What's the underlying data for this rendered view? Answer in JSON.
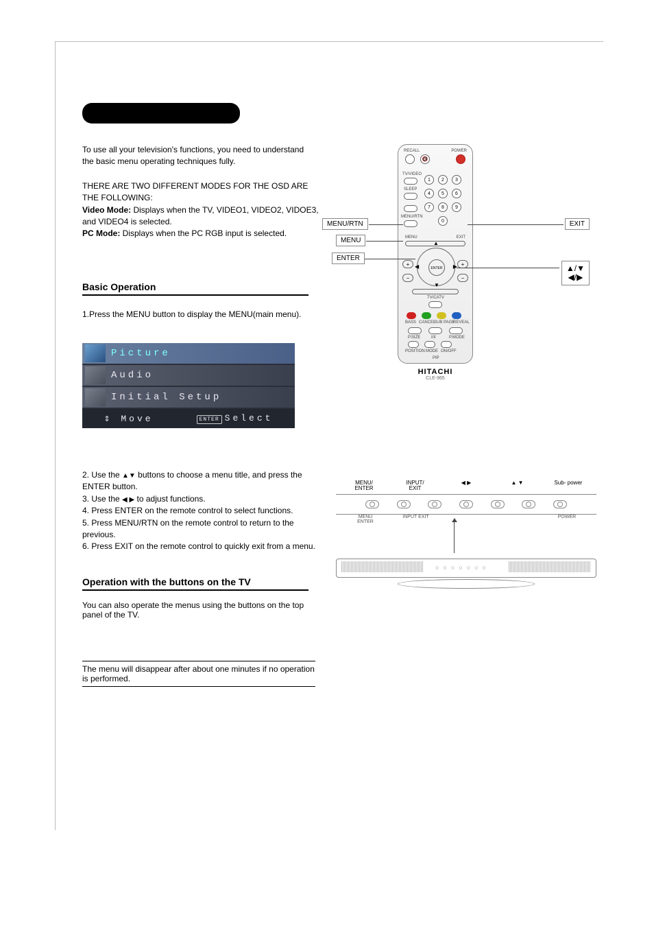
{
  "intro": "To use all your television's functions, you need to understand the basic menu operating techniques fully.",
  "modes": {
    "header": "THERE ARE TWO DIFFERENT MODES FOR THE OSD ARE THE FOLLOWING:",
    "video_label": "Video Mode:",
    "video_text": " Displays when the TV, VIDEO1, VIDEO2, VIDOE3, and VIDEO4 is selected.",
    "pc_label": "PC Mode:",
    "pc_text": " Displays when the PC RGB input is selected."
  },
  "section1_heading": "Basic Operation",
  "step1": "1.Press the MENU button to display the MENU(main menu).",
  "osd": {
    "items": [
      "Picture",
      "Audio",
      "Initial Setup"
    ],
    "footer_move": "Move",
    "footer_enter_badge": "ENTER",
    "footer_select": "Select"
  },
  "steps_2_6": {
    "s2a": "2. Use the ",
    "s2b": " buttons to choose a menu title, and press the ENTER button.",
    "s3a": "3. Use the ",
    "s3b": " to adjust functions.",
    "s4": "4. Press ENTER on the remote control to select functions.",
    "s5": "5. Press MENU/RTN on the remote control to return to the previous.",
    "s6": "6. Press EXIT on the remote control to quickly exit from a menu."
  },
  "section2_heading": "Operation with the buttons on the TV",
  "section2_text": "You can also operate the menus using the buttons on the top panel of the TV.",
  "note": "The menu will disappear after about one minutes if no operation is performed.",
  "remote": {
    "brand": "HITACHI",
    "model": "CLE-965",
    "labels": {
      "recall": "RECALL",
      "mute_icon": "🔇",
      "power": "POWER",
      "tvvideo": "TV/VIDEO",
      "sleep": "SLEEP",
      "menurtn": "MENU/RTN",
      "menu": "MENU",
      "exit": "EXIT",
      "enter": "ENTER",
      "tvcatv": "TV/CATV",
      "bass": "BASS",
      "cancel": "CANCEL",
      "subpage": "SUB PAGE",
      "reveal": "REVEAL",
      "psize": "P.SIZE",
      "hold": "I/II",
      "pmode": "P.MODE",
      "position": "POSITION",
      "mode": "MODE",
      "onoff": "ON/OFF",
      "pip": "PIP"
    },
    "callouts": {
      "menurtn": "MENU/RTN",
      "menu": "MENU",
      "enter": "ENTER",
      "exit": "EXIT",
      "arrows_top": "▲/▼",
      "arrows_bot": "◀/▶"
    }
  },
  "tv_top": {
    "labels": [
      "MENU/\nENTER",
      "INPUT/\nEXIT",
      "◀ ▶",
      "▲ ▼",
      "Sub-\npower"
    ],
    "sublabels": [
      "MENU\nENTER",
      "INPUT\nEXIT",
      "",
      "",
      "POWER"
    ]
  }
}
